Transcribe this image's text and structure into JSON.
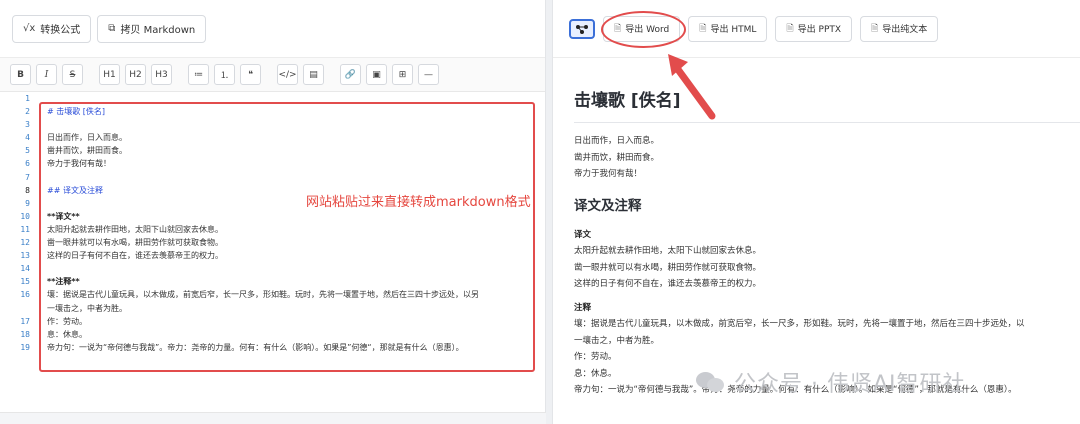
{
  "left_toolbar": {
    "convert_label": "转换公式",
    "copy_md_label": "拷贝 Markdown"
  },
  "format_buttons": [
    "B",
    "I",
    "S",
    "H1",
    "H2",
    "H3",
    "≔",
    "⒈",
    "❝",
    "</>",
    "▤",
    "🔗",
    "▣",
    "⊞",
    "—"
  ],
  "editor": {
    "line_numbers": [
      "1",
      "2",
      "3",
      "4",
      "5",
      "6",
      "7",
      "8",
      "9",
      "10",
      "11",
      "12",
      "13",
      "14",
      "15",
      "16",
      "",
      "17",
      "18",
      "19"
    ],
    "active_line": "8",
    "lines": [
      "",
      "# 击壤歌 [佚名]",
      "",
      "日出而作，日入而息。",
      "凿井而饮，耕田而食。",
      "帝力于我何有哉！",
      "",
      "## 译文及注释",
      "",
      "**译文**",
      "太阳升起就去耕作田地，太阳下山就回家去休息。",
      "凿一眼井就可以有水喝，耕田劳作就可获取食物。",
      "这样的日子有何不自在，谁还去羡慕帝王的权力。",
      "",
      "**注释**",
      "壤：据说是古代儿童玩具，以木做成，前宽后窄，长一尺多，形如鞋。玩时，先将一壤置于地，然后在三四十步远处，以另",
      "一壤击之，中者为胜。",
      "作：劳动。",
      "息：休息。",
      "帝力句：一说为“帝何德与我哉”。帝力：尧帝的力量。何有：有什么（影响）。如果是”何德“，那就是有什么（恩惠）。"
    ]
  },
  "annotation_text": "网站粘贴过来直接转成markdown格式",
  "right_toolbar": {
    "export_word": "导出 Word",
    "export_html": "导出 HTML",
    "export_pptx": "导出 PPTX",
    "export_text": "导出纯文本"
  },
  "preview": {
    "title": "击壤歌 [佚名]",
    "poem": [
      "日出而作，日入而息。",
      "凿井而饮，耕田而食。",
      "帝力于我何有哉！"
    ],
    "section_title": "译文及注释",
    "translation_label": "译文",
    "translation": [
      "太阳升起就去耕作田地，太阳下山就回家去休息。",
      "凿一眼井就可以有水喝，耕田劳作就可获取食物。",
      "这样的日子有何不自在，谁还去羡慕帝王的权力。"
    ],
    "notes_label": "注释",
    "notes": [
      "壤：据说是古代儿童玩具，以木做成，前宽后窄，长一尺多，形如鞋。玩时，先将一壤置于地，然后在三四十步远处，以",
      "一壤击之，中者为胜。",
      "作：劳动。",
      "息：休息。",
      "帝力句：一说为“帝何德与我哉”。帝力：尧帝的力量。何有：有什么（影响）。如果是“何德”，那就是有什么（恩惠）。"
    ]
  },
  "watermark": "公众号 · 伟贤AI智研社",
  "colors": {
    "highlight_red": "#e24c4c",
    "heading_blue": "#2a4dd8",
    "line_number_blue": "#3a7fc8"
  }
}
